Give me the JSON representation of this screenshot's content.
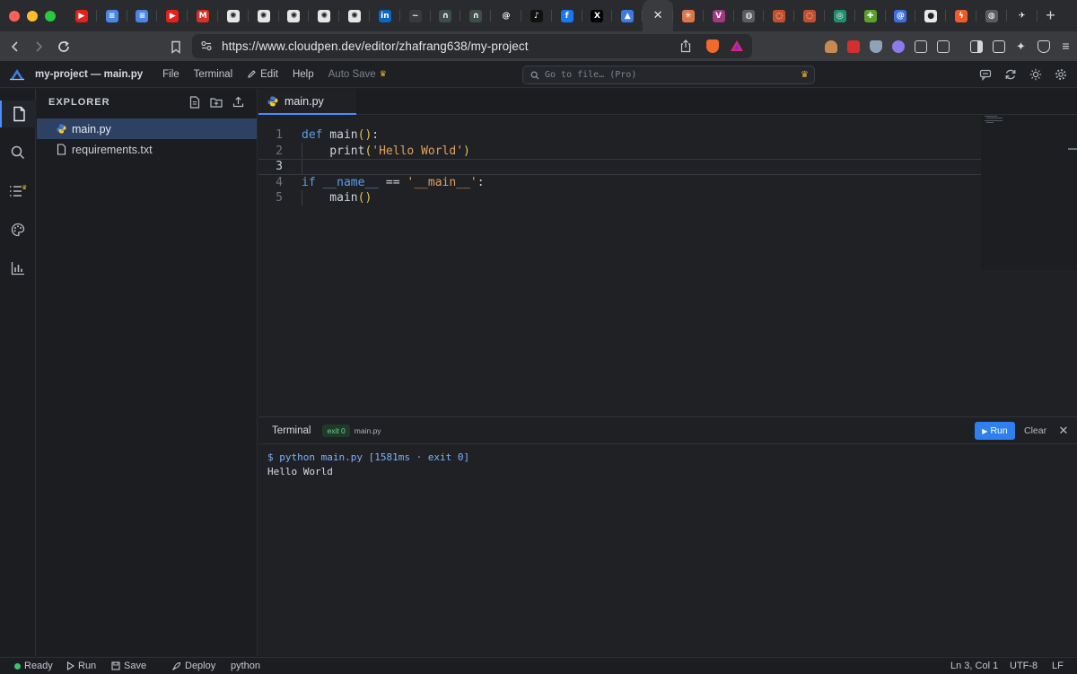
{
  "browser": {
    "tabs": [
      {
        "name": "youtube-icon",
        "color": "#e62117",
        "glyph": "▶"
      },
      {
        "name": "google-docs-icon",
        "color": "#4a86e8",
        "glyph": "≡"
      },
      {
        "name": "google-docs-icon",
        "color": "#4a86e8",
        "glyph": "≡"
      },
      {
        "name": "youtube-icon",
        "color": "#e62117",
        "glyph": "▶"
      },
      {
        "name": "gmail-icon",
        "color": "#d93025",
        "glyph": "M"
      },
      {
        "name": "chatgpt-icon",
        "color": "#e6e6e6",
        "glyph": "✺"
      },
      {
        "name": "chatgpt-icon",
        "color": "#e6e6e6",
        "glyph": "✺"
      },
      {
        "name": "chatgpt-icon",
        "color": "#e6e6e6",
        "glyph": "✺"
      },
      {
        "name": "chatgpt-icon",
        "color": "#e6e6e6",
        "glyph": "✺"
      },
      {
        "name": "chatgpt-icon",
        "color": "#e6e6e6",
        "glyph": "✺"
      },
      {
        "name": "linkedin-icon",
        "color": "#0a66c2",
        "glyph": "in"
      },
      {
        "name": "dark-tab-icon",
        "color": "#3a3a3a",
        "glyph": "~"
      },
      {
        "name": "headphones-icon",
        "color": "#3e4e48",
        "glyph": "∩"
      },
      {
        "name": "headphones-icon",
        "color": "#3e4e48",
        "glyph": "∩"
      },
      {
        "name": "threads-icon",
        "color": "#2a2b2e",
        "glyph": "@"
      },
      {
        "name": "tiktok-icon",
        "color": "#111111",
        "glyph": "♪"
      },
      {
        "name": "facebook-icon",
        "color": "#1877f2",
        "glyph": "f"
      },
      {
        "name": "x-icon",
        "color": "#000000",
        "glyph": "X"
      },
      {
        "name": "cloudpen-icon",
        "color": "#3d7be0",
        "glyph": "▲"
      },
      {
        "name": "close-tab-icon",
        "color": "transparent",
        "glyph": "✕",
        "active": true
      },
      {
        "name": "claude-icon",
        "color": "#d9774a",
        "glyph": "✳"
      },
      {
        "name": "vivaldi-icon",
        "color": "#a0397f",
        "glyph": "V"
      },
      {
        "name": "globe-icon",
        "color": "#5a5c61",
        "glyph": "◍"
      },
      {
        "name": "ring-icon",
        "color": "#c2502f",
        "glyph": "◌"
      },
      {
        "name": "ring-icon",
        "color": "#c2502f",
        "glyph": "◌"
      },
      {
        "name": "perplexity-icon",
        "color": "#1f8f6e",
        "glyph": "◎"
      },
      {
        "name": "puzzle-icon",
        "color": "#5aa02c",
        "glyph": "✚"
      },
      {
        "name": "at-icon",
        "color": "#3b6fe0",
        "glyph": "@"
      },
      {
        "name": "github-icon",
        "color": "#e8e8e8",
        "glyph": "●"
      },
      {
        "name": "bolt-icon",
        "color": "#f05a28",
        "glyph": "ϟ"
      },
      {
        "name": "globe-icon",
        "color": "#5a5c61",
        "glyph": "◍"
      },
      {
        "name": "plane-icon",
        "color": "#2a2b2e",
        "glyph": "✈"
      }
    ],
    "url": "https://www.cloudpen.dev/editor/zhafrang638/my-project"
  },
  "app": {
    "title": "my-project — main.py",
    "menu": {
      "file": "File",
      "terminal": "Terminal",
      "edit": "Edit",
      "help": "Help",
      "auto_save": "Auto Save"
    },
    "goto_placeholder": "Go to file… (Pro)"
  },
  "explorer": {
    "title": "EXPLORER",
    "files": [
      {
        "name": "main.py",
        "selected": true
      },
      {
        "name": "requirements.txt",
        "selected": false
      }
    ]
  },
  "editor": {
    "tab_label": "main.py",
    "cursor_line": 3
  },
  "terminal": {
    "title": "Terminal",
    "exit_badge": "exit 0",
    "file": "main.py",
    "run_label": "Run",
    "clear_label": "Clear",
    "lines": [
      {
        "text": "$ python main.py [1581ms · exit 0]",
        "kind": "cmd"
      },
      {
        "text": "Hello World",
        "kind": "out"
      }
    ]
  },
  "status": {
    "ready": "Ready",
    "run": "Run",
    "save": "Save",
    "deploy": "Deploy",
    "language": "python",
    "position": "Ln 3, Col 1",
    "encoding": "UTF-8",
    "eol": "LF"
  }
}
